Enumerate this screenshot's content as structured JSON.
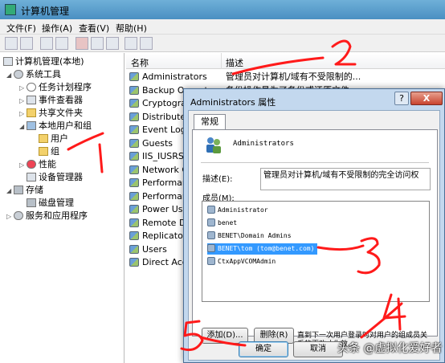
{
  "window": {
    "title": "计算机管理"
  },
  "menu": [
    "文件(F)",
    "操作(A)",
    "查看(V)",
    "帮助(H)"
  ],
  "tree": [
    {
      "label": "计算机管理(本地)",
      "icon": "computer-icon"
    },
    {
      "label": "系统工具",
      "icon": "tools-icon"
    },
    {
      "label": "任务计划程序",
      "icon": "clock-icon"
    },
    {
      "label": "事件查看器",
      "icon": "event-viewer-icon"
    },
    {
      "label": "共享文件夹",
      "icon": "shared-folder-icon"
    },
    {
      "label": "本地用户和组",
      "icon": "users-icon"
    },
    {
      "label": "用户",
      "icon": "folder-icon"
    },
    {
      "label": "组",
      "icon": "folder-icon"
    },
    {
      "label": "性能",
      "icon": "performance-icon"
    },
    {
      "label": "设备管理器",
      "icon": "device-manager-icon"
    },
    {
      "label": "存储",
      "icon": "storage-icon"
    },
    {
      "label": "磁盘管理",
      "icon": "disk-icon"
    },
    {
      "label": "服务和应用程序",
      "icon": "services-icon"
    }
  ],
  "list": {
    "columns": [
      "名称",
      "描述"
    ],
    "rows": [
      {
        "name": "Administrators",
        "desc": "管理员对计算机/域有不受限制的..."
      },
      {
        "name": "Backup Operators",
        "desc": "备份操作员为了备份或还原文件..."
      },
      {
        "name": "Cryptograp",
        "desc": ""
      },
      {
        "name": "Distributed",
        "desc": ""
      },
      {
        "name": "Event Log R",
        "desc": ""
      },
      {
        "name": "Guests",
        "desc": ""
      },
      {
        "name": "IIS_IUSRS",
        "desc": ""
      },
      {
        "name": "Network Co",
        "desc": ""
      },
      {
        "name": "Performanc",
        "desc": ""
      },
      {
        "name": "Performanc",
        "desc": ""
      },
      {
        "name": "Power User",
        "desc": ""
      },
      {
        "name": "Remote Des",
        "desc": ""
      },
      {
        "name": "Replicator",
        "desc": ""
      },
      {
        "name": "Users",
        "desc": ""
      },
      {
        "name": "Direct Acces",
        "desc": ""
      }
    ]
  },
  "dialog": {
    "title": "Administrators 属性",
    "help": "?",
    "close": "X",
    "tab": "常规",
    "group_name": "Administrators",
    "desc_label": "描述(E):",
    "desc_value": "管理员对计算机/域有不受限制的完全访问权",
    "members_label": "成员(M):",
    "members": [
      "Administrator",
      "benet",
      "BENET\\Domain Admins",
      "BENET\\tom (tom@benet.com)",
      "CtxAppVCOMAdmin"
    ],
    "add_button": "添加(D)...",
    "remove_button": "删除(R)",
    "note": "直到下一次用户登录时对用户的组成员关系的更改才生效。",
    "ok_button": "确定",
    "cancel_button": "取消"
  },
  "watermark": "头条 @虚拟化爱好者",
  "annotations": [
    "1",
    "2",
    "3",
    "4",
    "5"
  ],
  "colors": {
    "annotation": "#ff1a1a",
    "selection": "#3399ff",
    "titlebar": "#5b9fd0"
  }
}
